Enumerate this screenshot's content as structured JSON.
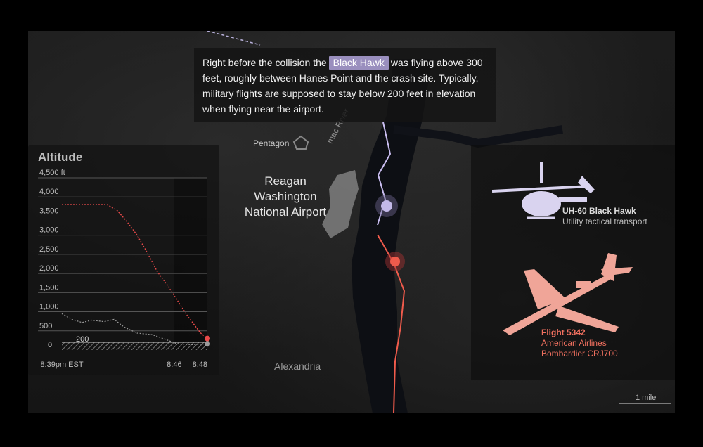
{
  "caption": {
    "before": "Right before the collision the",
    "highlight": "Black Hawk",
    "after": "was flying above 300 feet, roughly between Hanes Point and the crash site. Typically, military flights are supposed to stay below 200 feet in elevation when flying near the airport."
  },
  "map": {
    "labels": {
      "pentagon": "Pentagon",
      "airport_line1": "Reagan",
      "airport_line2": "Washington",
      "airport_line3": "National Airport",
      "river": "mac River",
      "alexandria": "Alexandria"
    },
    "scale_label": "1 mile"
  },
  "aircraft": {
    "helicopter": {
      "name": "UH-60 Black Hawk",
      "description": "Utility tactical transport",
      "color": "#d9d3ef"
    },
    "airplane": {
      "name": "Flight 5342",
      "airline": "American Airlines",
      "model": "Bombardier CRJ700",
      "color": "#f08a7a"
    }
  },
  "chart_data": {
    "type": "line",
    "title": "Altitude",
    "ylim": [
      0,
      4500
    ],
    "y_ticks": [
      "4,500 ft",
      "4,000",
      "3,500",
      "3,000",
      "2,500",
      "2,000",
      "1,500",
      "1,000",
      "500",
      "0"
    ],
    "x_ticks": [
      "8:39pm EST",
      "8:46",
      "8:48"
    ],
    "reference_line": {
      "value": 200,
      "label": "200"
    },
    "series": [
      {
        "name": "Flight 5342",
        "color": "#e84a4a",
        "points": [
          [
            0,
            3800
          ],
          [
            0.45,
            3800
          ],
          [
            0.55,
            3650
          ],
          [
            0.65,
            3350
          ],
          [
            0.75,
            3000
          ],
          [
            0.85,
            2550
          ],
          [
            0.95,
            2050
          ],
          [
            1.05,
            1700
          ],
          [
            1.15,
            1300
          ],
          [
            1.25,
            900
          ],
          [
            1.38,
            450
          ],
          [
            1.45,
            300
          ]
        ]
      },
      {
        "name": "UH-60 Black Hawk",
        "color": "#9a9a9a",
        "points": [
          [
            0,
            950
          ],
          [
            0.1,
            800
          ],
          [
            0.2,
            720
          ],
          [
            0.3,
            780
          ],
          [
            0.42,
            740
          ],
          [
            0.52,
            800
          ],
          [
            0.62,
            600
          ],
          [
            0.75,
            440
          ],
          [
            0.9,
            400
          ],
          [
            1.05,
            260
          ],
          [
            1.15,
            160
          ],
          [
            1.3,
            140
          ],
          [
            1.45,
            160
          ]
        ]
      }
    ],
    "x_range": [
      0,
      1.45
    ]
  }
}
